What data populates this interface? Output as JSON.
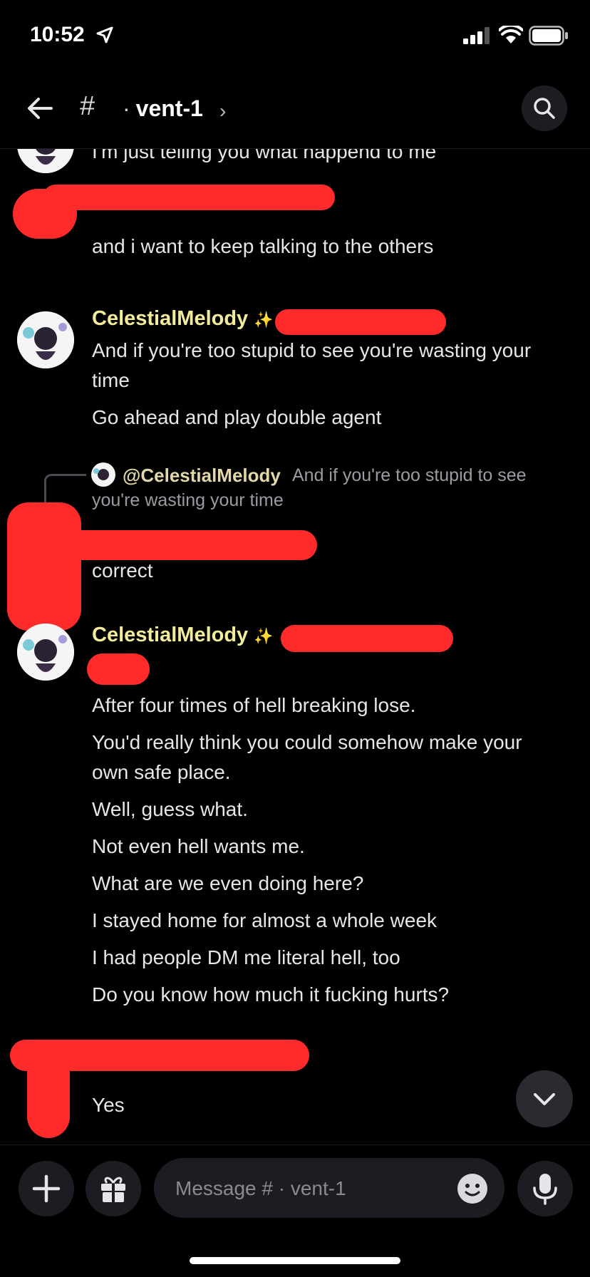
{
  "status_bar": {
    "time": "10:52"
  },
  "header": {
    "hash": "#",
    "dot": "·",
    "channel_name": "vent-1",
    "chevron": "›"
  },
  "messages": {
    "m1_text": "I'm just telling you what happend to me",
    "m2_text": "and i want to keep talking to the others",
    "m3_author": "CelestialMelody",
    "m3_badge": "✨",
    "m3_line1": "And if you're too stupid to see you're wasting your",
    "m3_line1b": "time",
    "m3_line2": "Go ahead and play double agent",
    "reply_mention": "@CelestialMelody",
    "reply_preview_a": "And if you're too stupid to see",
    "reply_preview_b": "you're wasting your time",
    "m4_text": "correct",
    "m5_author": "CelestialMelody",
    "m5_badge": "✨",
    "m5_lines": [
      "After four times of hell breaking lose.",
      "You'd really think you could somehow make your",
      "own safe place.",
      "Well, guess what.",
      "Not even hell wants me.",
      "What are we even doing here?",
      "I stayed home for almost a whole week",
      "I had people DM me literal hell, too",
      "Do you know how much it fucking hurts?"
    ],
    "m6_text": "Yes"
  },
  "composer": {
    "placeholder": "Message # · vent-1"
  },
  "colors": {
    "background": "#000000",
    "username": "#f4eb9b",
    "redaction": "#ff2b2b",
    "surface": "#1c1d22"
  }
}
